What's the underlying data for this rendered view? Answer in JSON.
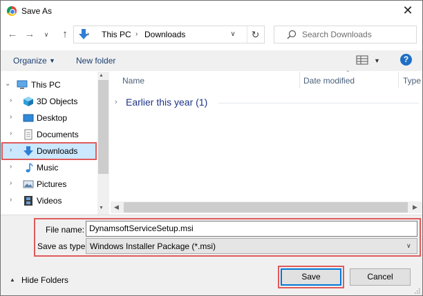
{
  "window": {
    "title": "Save As",
    "close_glyph": "✕"
  },
  "nav_buttons": {
    "back_glyph": "←",
    "forward_glyph": "→",
    "recent_glyph": "∨",
    "up_glyph": "↑"
  },
  "address": {
    "separator": "›",
    "crumbs": [
      "This PC",
      "Downloads"
    ],
    "dropdown_glyph": "∨",
    "refresh_glyph": "↻",
    "icon": "download-arrow-icon"
  },
  "search": {
    "placeholder": "Search Downloads"
  },
  "toolbar": {
    "organize_label": "Organize",
    "organize_caret": "▼",
    "new_folder_label": "New folder",
    "views_caret": "▼",
    "help_label": "?"
  },
  "sidebar": {
    "items": [
      {
        "label": "This PC",
        "icon": "computer-icon",
        "expanded": true
      },
      {
        "label": "3D Objects",
        "icon": "cube-icon"
      },
      {
        "label": "Desktop",
        "icon": "desktop-icon"
      },
      {
        "label": "Documents",
        "icon": "document-icon"
      },
      {
        "label": "Downloads",
        "icon": "download-arrow-icon",
        "selected": true
      },
      {
        "label": "Music",
        "icon": "music-note-icon"
      },
      {
        "label": "Pictures",
        "icon": "picture-icon"
      },
      {
        "label": "Videos",
        "icon": "film-icon"
      }
    ],
    "collapsed_chevron": "›",
    "expanded_chevron": "⌄"
  },
  "file_list": {
    "columns": [
      "Name",
      "Date modified",
      "Type"
    ],
    "sort_caret": "⌃",
    "groups": [
      {
        "label": "Earlier this year (1)",
        "chevron": "›"
      }
    ]
  },
  "scrollbars": {
    "up": "▲",
    "down": "▼",
    "left": "◀",
    "right": "▶"
  },
  "form": {
    "file_name_label": "File name:",
    "file_name_value": "DynamsoftServiceSetup.msi",
    "save_type_label": "Save as type:",
    "save_type_value": "Windows Installer Package (*.msi)",
    "save_type_caret": "∨"
  },
  "footer": {
    "hide_folders_label": "Hide Folders",
    "hide_folders_caret": "▲",
    "save_label": "Save",
    "cancel_label": "Cancel"
  },
  "colors": {
    "highlight": "#e05a5a",
    "selection": "#cce8ff",
    "accent": "#0078d7",
    "group_text": "#1e3287"
  }
}
